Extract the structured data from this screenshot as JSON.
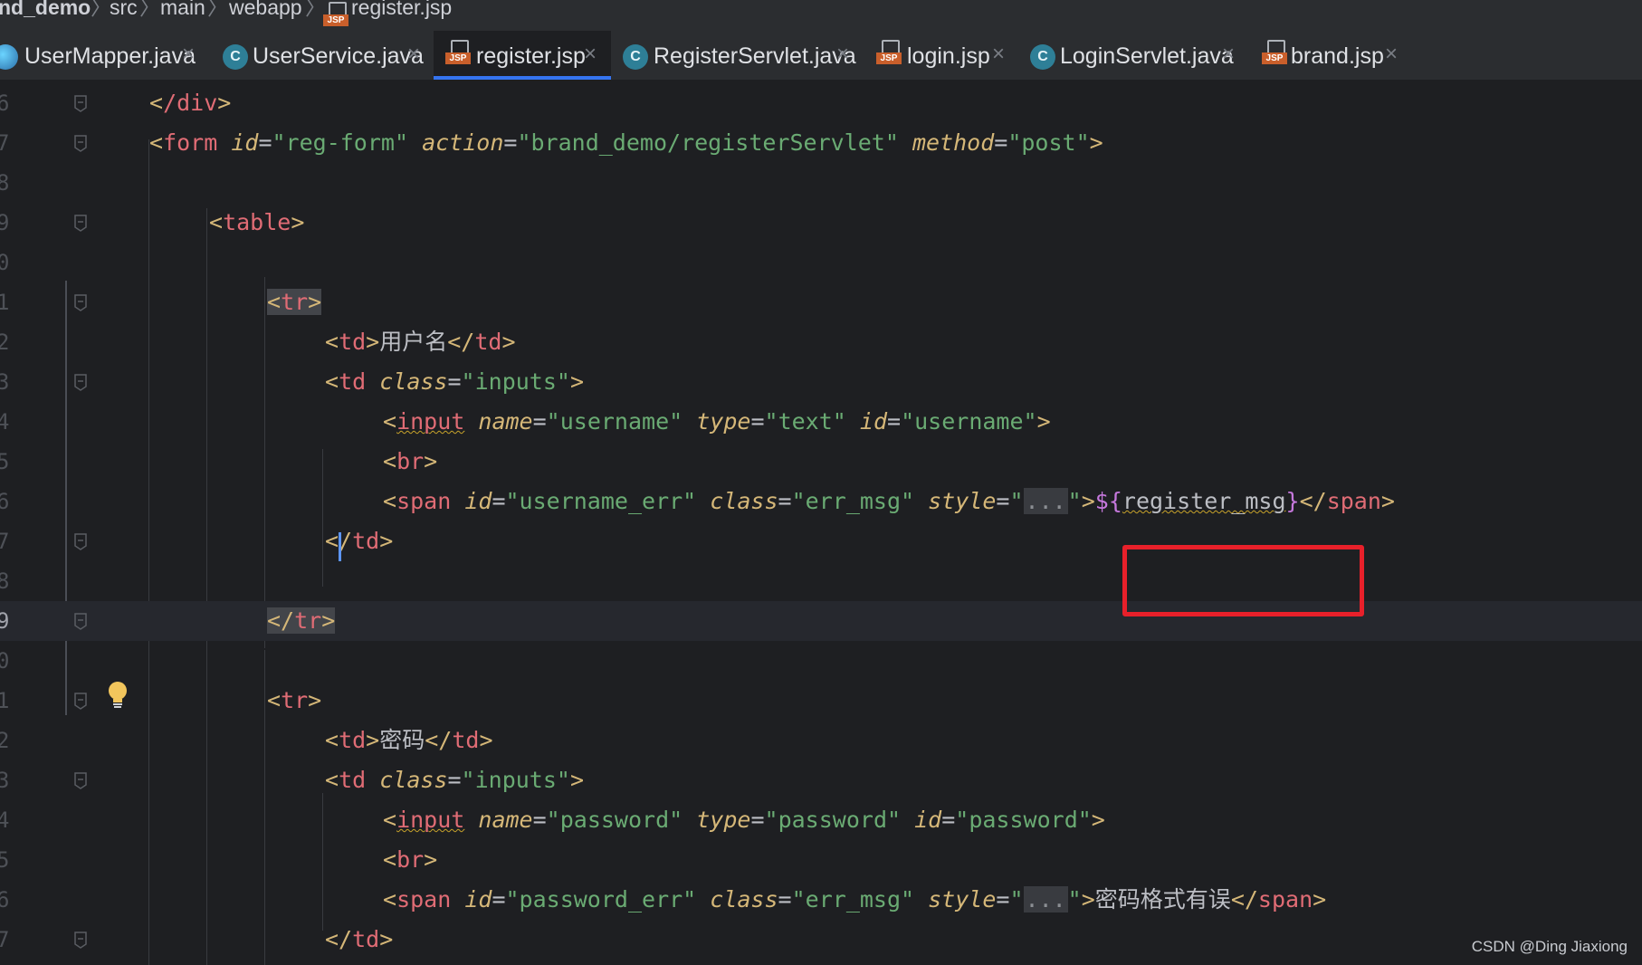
{
  "breadcrumb": {
    "items": [
      "nd_demo",
      "src",
      "main",
      "webapp",
      "register.jsp"
    ],
    "file_icon": "jsp-file-icon"
  },
  "tabs": [
    {
      "label": "UserMapper.java",
      "icon": "mybatis-mapper-icon",
      "active": false
    },
    {
      "label": "UserService.java",
      "icon": "java-class-icon",
      "active": false
    },
    {
      "label": "register.jsp",
      "icon": "jsp-file-icon",
      "active": true
    },
    {
      "label": "RegisterServlet.java",
      "icon": "java-class-icon",
      "active": false
    },
    {
      "label": "login.jsp",
      "icon": "jsp-file-icon",
      "active": false
    },
    {
      "label": "LoginServlet.java",
      "icon": "java-class-icon",
      "active": false
    },
    {
      "label": "brand.jsp",
      "icon": "jsp-file-icon",
      "active": false
    }
  ],
  "tab_close_glyph": "×",
  "class_icon_letter": "C",
  "jsp_badge": "JSP",
  "editor": {
    "line_numbers": [
      "6",
      "7",
      "8",
      "9",
      "0",
      "1",
      "2",
      "3",
      "4",
      "5",
      "6",
      "7",
      "8",
      "9",
      "0",
      "1",
      "2",
      "3",
      "4",
      "5",
      "6",
      "7"
    ],
    "current_line": "9",
    "lines": [
      [
        [
          "tg",
          "<"
        ],
        [
          "tagname",
          "/div"
        ],
        [
          "tg",
          ">"
        ]
      ],
      [
        [
          "tg",
          "<"
        ],
        [
          "tagname",
          "form "
        ],
        [
          "attr",
          "id"
        ],
        [
          "br",
          "="
        ],
        [
          "str",
          "\"reg-form\" "
        ],
        [
          "attr",
          "action"
        ],
        [
          "br",
          "="
        ],
        [
          "str",
          "\"brand_demo/registerServlet\" "
        ],
        [
          "attr",
          "method"
        ],
        [
          "br",
          "="
        ],
        [
          "str",
          "\"post\""
        ],
        [
          "tg",
          ">"
        ]
      ],
      [],
      [
        [
          "tg",
          "<"
        ],
        [
          "tagname",
          "table"
        ],
        [
          "tg",
          ">"
        ]
      ],
      [],
      [
        [
          "tg",
          "<"
        ],
        [
          "tagname",
          "tr"
        ],
        [
          "tg",
          ">"
        ]
      ],
      [
        [
          "tg",
          "<"
        ],
        [
          "tagname",
          "td"
        ],
        [
          "tg",
          ">"
        ],
        [
          "txt",
          "用户名"
        ],
        [
          "tg",
          "</"
        ],
        [
          "tagname",
          "td"
        ],
        [
          "tg",
          ">"
        ]
      ],
      [
        [
          "tg",
          "<"
        ],
        [
          "tagname",
          "td "
        ],
        [
          "attr",
          "class"
        ],
        [
          "br",
          "="
        ],
        [
          "str",
          "\"inputs\""
        ],
        [
          "tg",
          ">"
        ]
      ],
      [
        [
          "tg",
          "<"
        ],
        [
          "tagname",
          "input"
        ],
        [
          "txt",
          " "
        ],
        [
          "attr",
          "name"
        ],
        [
          "br",
          "="
        ],
        [
          "str",
          "\"username\" "
        ],
        [
          "attr",
          "type"
        ],
        [
          "br",
          "="
        ],
        [
          "str",
          "\"text\" "
        ],
        [
          "attr",
          "id"
        ],
        [
          "br",
          "="
        ],
        [
          "str",
          "\"username\""
        ],
        [
          "tg",
          ">"
        ]
      ],
      [
        [
          "tg",
          "<"
        ],
        [
          "tagname",
          "br"
        ],
        [
          "tg",
          ">"
        ]
      ],
      [
        [
          "tg",
          "<"
        ],
        [
          "tagname",
          "span "
        ],
        [
          "attr",
          "id"
        ],
        [
          "br",
          "="
        ],
        [
          "str",
          "\"username_err\" "
        ],
        [
          "attr",
          "class"
        ],
        [
          "br",
          "="
        ],
        [
          "str",
          "\"err_msg\" "
        ],
        [
          "attr",
          "style"
        ],
        [
          "br",
          "="
        ],
        [
          "str",
          "\""
        ],
        [
          "fold",
          "..."
        ],
        [
          "str",
          "\""
        ],
        [
          "tg",
          ">"
        ],
        [
          "el",
          "${"
        ],
        [
          "txt",
          "register_msg"
        ],
        [
          "el",
          "}"
        ],
        [
          "tg",
          "</"
        ],
        [
          "tagname",
          "span"
        ],
        [
          "tg",
          ">"
        ]
      ],
      [
        [
          "tg",
          "</"
        ],
        [
          "tagname",
          "td"
        ],
        [
          "tg",
          ">"
        ]
      ],
      [],
      [
        [
          "tg",
          "</"
        ],
        [
          "tagname",
          "tr"
        ],
        [
          "tg",
          ">"
        ]
      ],
      [],
      [
        [
          "tg",
          "<"
        ],
        [
          "tagname",
          "tr"
        ],
        [
          "tg",
          ">"
        ]
      ],
      [
        [
          "tg",
          "<"
        ],
        [
          "tagname",
          "td"
        ],
        [
          "tg",
          ">"
        ],
        [
          "txt",
          "密码"
        ],
        [
          "tg",
          "</"
        ],
        [
          "tagname",
          "td"
        ],
        [
          "tg",
          ">"
        ]
      ],
      [
        [
          "tg",
          "<"
        ],
        [
          "tagname",
          "td "
        ],
        [
          "attr",
          "class"
        ],
        [
          "br",
          "="
        ],
        [
          "str",
          "\"inputs\""
        ],
        [
          "tg",
          ">"
        ]
      ],
      [
        [
          "tg",
          "<"
        ],
        [
          "tagname",
          "input"
        ],
        [
          "txt",
          " "
        ],
        [
          "attr",
          "name"
        ],
        [
          "br",
          "="
        ],
        [
          "str",
          "\"password\" "
        ],
        [
          "attr",
          "type"
        ],
        [
          "br",
          "="
        ],
        [
          "str",
          "\"password\" "
        ],
        [
          "attr",
          "id"
        ],
        [
          "br",
          "="
        ],
        [
          "str",
          "\"password\""
        ],
        [
          "tg",
          ">"
        ]
      ],
      [
        [
          "tg",
          "<"
        ],
        [
          "tagname",
          "br"
        ],
        [
          "tg",
          ">"
        ]
      ],
      [
        [
          "tg",
          "<"
        ],
        [
          "tagname",
          "span "
        ],
        [
          "attr",
          "id"
        ],
        [
          "br",
          "="
        ],
        [
          "str",
          "\"password_err\" "
        ],
        [
          "attr",
          "class"
        ],
        [
          "br",
          "="
        ],
        [
          "str",
          "\"err_msg\" "
        ],
        [
          "attr",
          "style"
        ],
        [
          "br",
          "="
        ],
        [
          "str",
          "\""
        ],
        [
          "fold",
          "..."
        ],
        [
          "str",
          "\""
        ],
        [
          "tg",
          ">"
        ],
        [
          "txt",
          "密码格式有误"
        ],
        [
          "tg",
          "</"
        ],
        [
          "tagname",
          "span"
        ],
        [
          "tg",
          ">"
        ]
      ],
      [
        [
          "tg",
          "</"
        ],
        [
          "tagname",
          "td"
        ],
        [
          "tg",
          ">"
        ]
      ]
    ]
  },
  "annotation": {
    "color": "#e8202a",
    "target": "register_msg"
  },
  "watermark": "CSDN @Ding Jiaxiong",
  "colors": {
    "background": "#1e1f22",
    "tab_active_underline": "#3574f0",
    "tag_name": "#e06c75",
    "attribute": "#d5b778",
    "string": "#6aab73",
    "el_expression": "#c678dd"
  }
}
